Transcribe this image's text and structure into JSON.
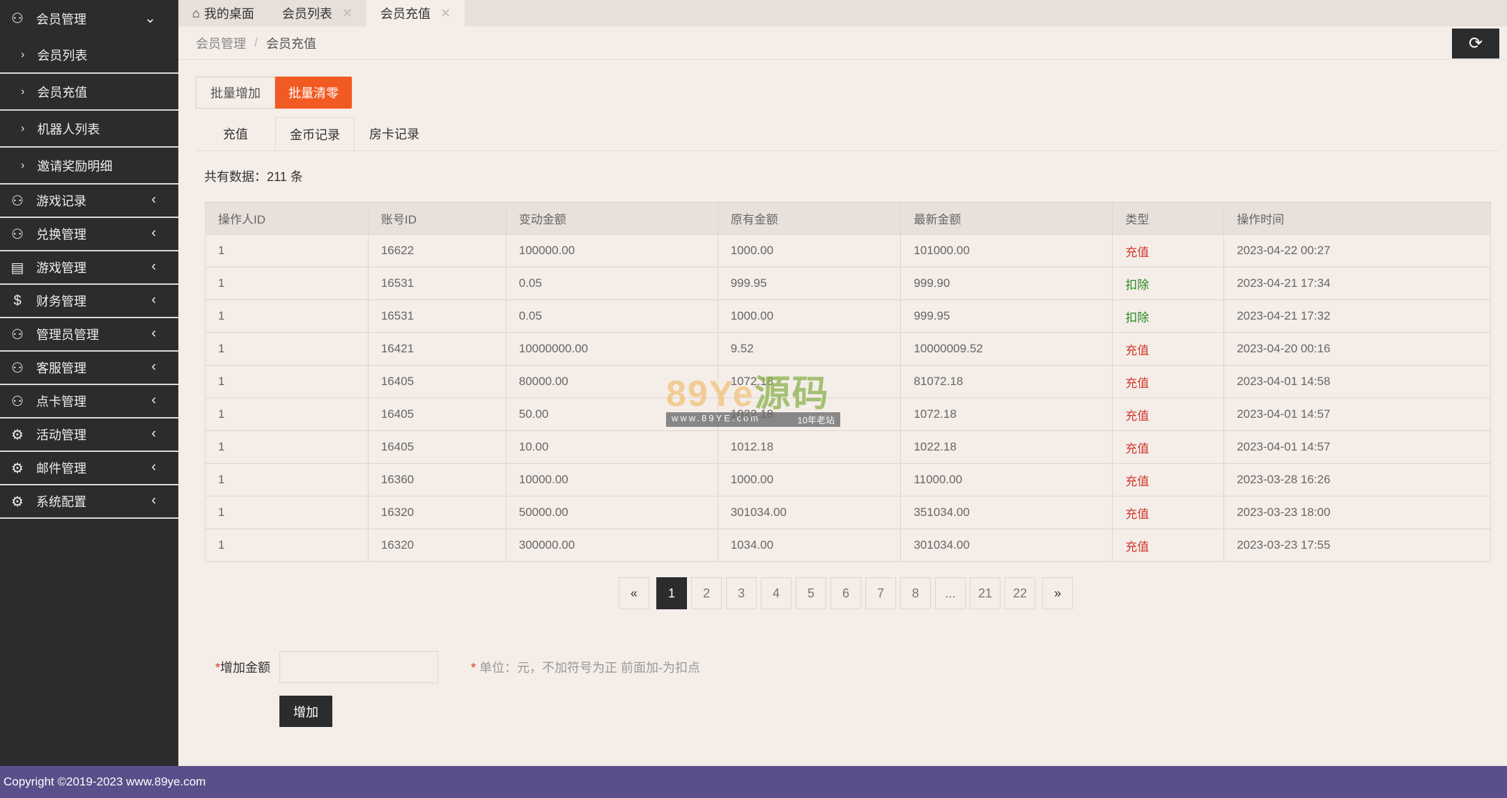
{
  "sidebar": {
    "top": {
      "label": "会员管理",
      "icon": "user-icon"
    },
    "subitems": [
      {
        "label": "会员列表"
      },
      {
        "label": "会员充值"
      },
      {
        "label": "机器人列表"
      },
      {
        "label": "邀请奖励明细"
      }
    ],
    "items": [
      {
        "label": "游戏记录",
        "icon": "user-icon"
      },
      {
        "label": "兑换管理",
        "icon": "user-icon"
      },
      {
        "label": "游戏管理",
        "icon": "document-icon"
      },
      {
        "label": "财务管理",
        "icon": "dollar-icon"
      },
      {
        "label": "管理员管理",
        "icon": "admin-icon"
      },
      {
        "label": "客服管理",
        "icon": "admin-icon"
      },
      {
        "label": "点卡管理",
        "icon": "user-icon"
      },
      {
        "label": "活动管理",
        "icon": "gear-icon"
      },
      {
        "label": "邮件管理",
        "icon": "gear-icon"
      },
      {
        "label": "系统配置",
        "icon": "gear-icon"
      }
    ]
  },
  "tabs": [
    {
      "label": "我的桌面",
      "close": ""
    },
    {
      "label": "会员列表",
      "close": "✕"
    },
    {
      "label": "会员充值",
      "close": "✕"
    }
  ],
  "breadcrumb": {
    "parent": "会员管理",
    "sep": "/",
    "current": "会员充值"
  },
  "actions": {
    "batch_add": "批量增加",
    "batch_clear": "批量清零"
  },
  "subtabs": [
    {
      "label": "充值"
    },
    {
      "label": "金币记录"
    },
    {
      "label": "房卡记录"
    }
  ],
  "total": "共有数据：211 条",
  "table": {
    "headers": [
      "操作人ID",
      "账号ID",
      "变动金额",
      "原有金额",
      "最新金额",
      "类型",
      "操作时间"
    ],
    "rows": [
      [
        "1",
        "16622",
        "100000.00",
        "1000.00",
        "101000.00",
        "充值",
        "2023-04-22 00:27"
      ],
      [
        "1",
        "16531",
        "0.05",
        "999.95",
        "999.90",
        "扣除",
        "2023-04-21 17:34"
      ],
      [
        "1",
        "16531",
        "0.05",
        "1000.00",
        "999.95",
        "扣除",
        "2023-04-21 17:32"
      ],
      [
        "1",
        "16421",
        "10000000.00",
        "9.52",
        "10000009.52",
        "充值",
        "2023-04-20 00:16"
      ],
      [
        "1",
        "16405",
        "80000.00",
        "1072.18",
        "81072.18",
        "充值",
        "2023-04-01 14:58"
      ],
      [
        "1",
        "16405",
        "50.00",
        "1022.18",
        "1072.18",
        "充值",
        "2023-04-01 14:57"
      ],
      [
        "1",
        "16405",
        "10.00",
        "1012.18",
        "1022.18",
        "充值",
        "2023-04-01 14:57"
      ],
      [
        "1",
        "16360",
        "10000.00",
        "1000.00",
        "11000.00",
        "充值",
        "2023-03-28 16:26"
      ],
      [
        "1",
        "16320",
        "50000.00",
        "301034.00",
        "351034.00",
        "充值",
        "2023-03-23 18:00"
      ],
      [
        "1",
        "16320",
        "300000.00",
        "1034.00",
        "301034.00",
        "充值",
        "2023-03-23 17:55"
      ]
    ]
  },
  "pagination": {
    "prev": "«",
    "pages": [
      "1",
      "2",
      "3",
      "4",
      "5",
      "6",
      "7",
      "8",
      "...",
      "21",
      "22"
    ],
    "current": "1",
    "next": "»"
  },
  "form": {
    "label": "增加金额",
    "required": "*",
    "value": "",
    "hint_star": "*",
    "hint": " 单位：元，不加符号为正 前面加-为扣点",
    "submit": "增加"
  },
  "footer": "Copyright ©2019-2023 www.89ye.com",
  "watermark": {
    "main": "89Ye",
    "cn": "源码",
    "url": "www.89YE.com",
    "tag": "10年老站"
  },
  "colors": {
    "accent": "#f15a22",
    "sidebar": "#2b2c2e",
    "footer": "#5a4f8a",
    "recharge": "#d0392e",
    "deduct": "#2a8a1f"
  }
}
